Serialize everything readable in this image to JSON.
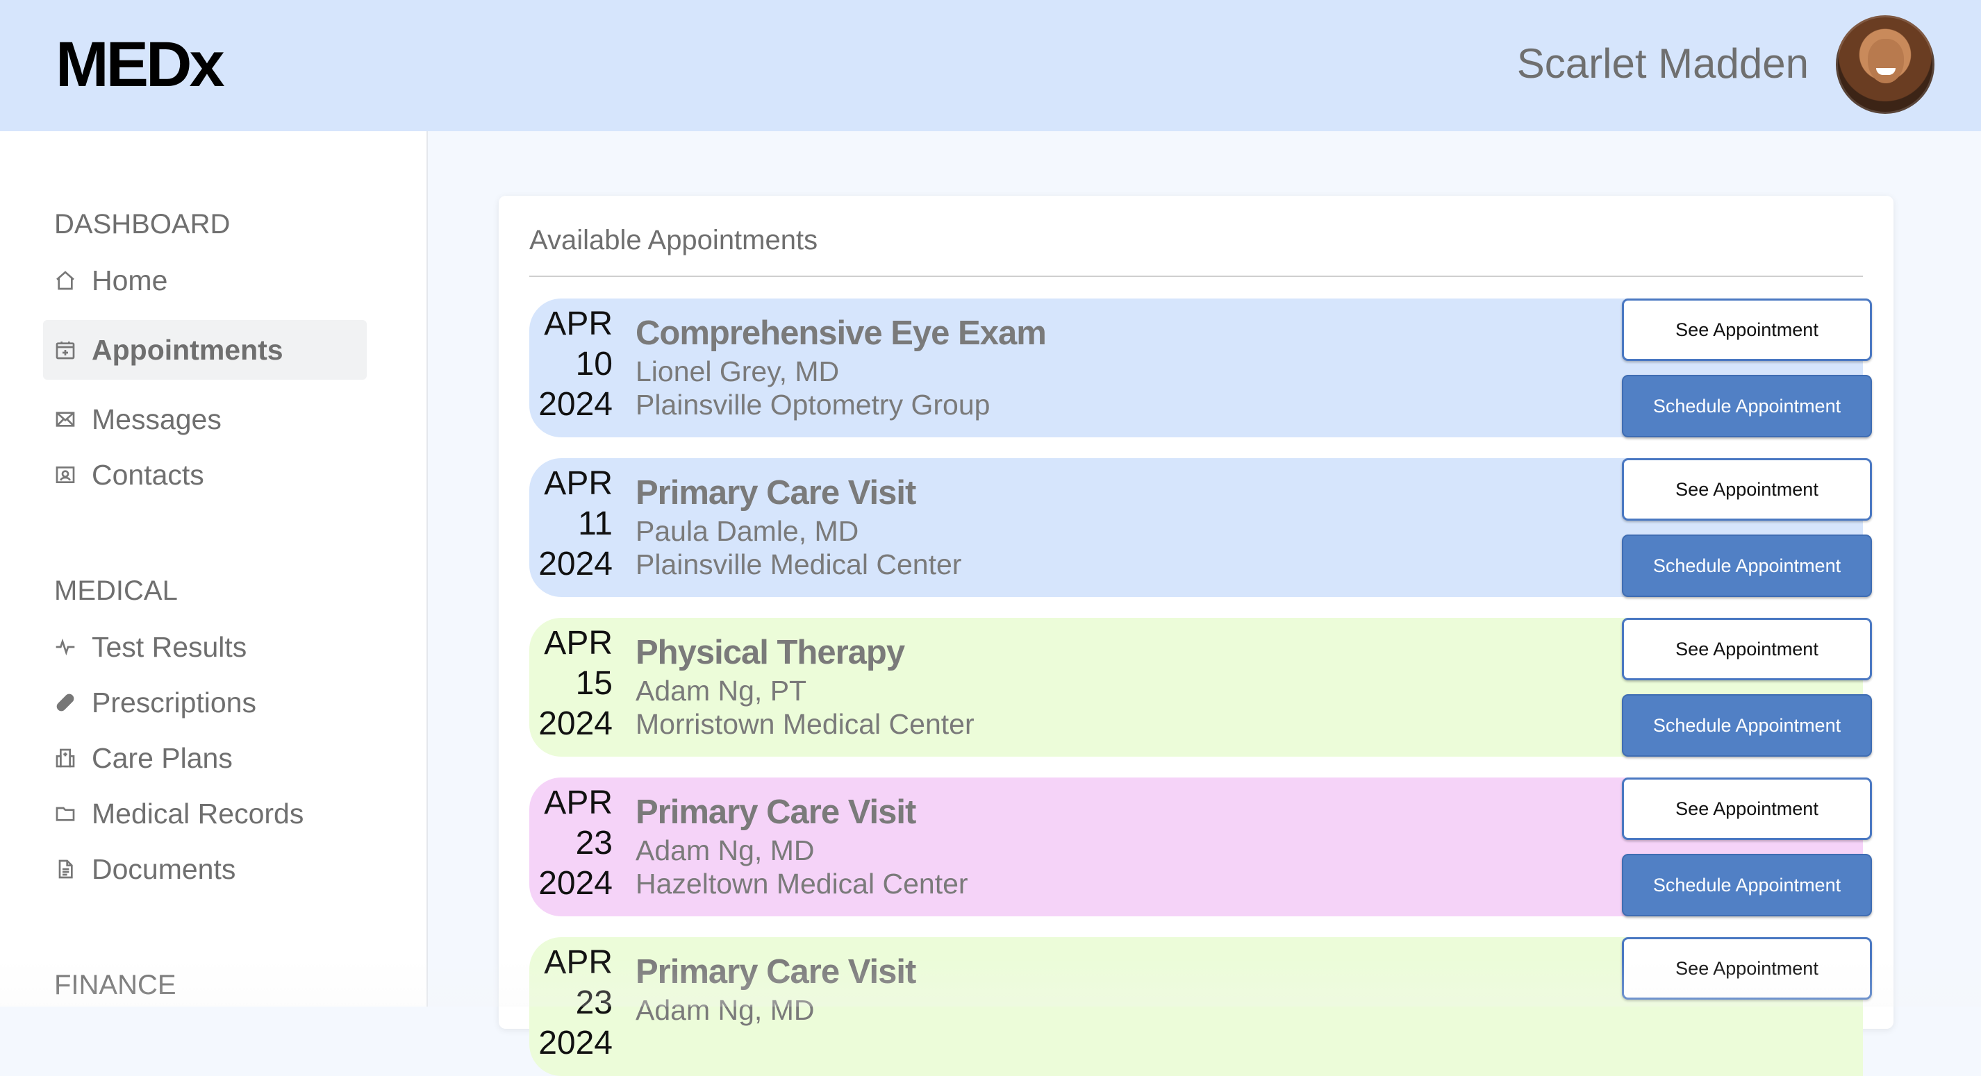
{
  "header": {
    "logo": "MEDx",
    "user_name": "Scarlet Madden",
    "avatar": "user-avatar-photo"
  },
  "sidebar": {
    "sections": [
      {
        "title": "DASHBOARD",
        "items": [
          {
            "label": "Home",
            "icon": "home-icon"
          },
          {
            "label": "Appointments",
            "icon": "calendar-plus-icon",
            "active": true
          },
          {
            "label": "Messages",
            "icon": "envelope-icon"
          },
          {
            "label": "Contacts",
            "icon": "contact-card-icon"
          }
        ]
      },
      {
        "title": "MEDICAL",
        "items": [
          {
            "label": "Test Results",
            "icon": "pulse-icon"
          },
          {
            "label": "Prescriptions",
            "icon": "pill-icon"
          },
          {
            "label": "Care Plans",
            "icon": "hospital-icon"
          },
          {
            "label": "Medical Records",
            "icon": "folder-icon"
          },
          {
            "label": "Documents",
            "icon": "document-icon"
          }
        ]
      },
      {
        "title": "FINANCE",
        "items": []
      }
    ]
  },
  "main": {
    "card_title": "Available Appointments",
    "see_label": "See Appointment",
    "schedule_label": "Schedule Appointment",
    "appointments": [
      {
        "month": "APR",
        "day": "10",
        "year": "2024",
        "title": "Comprehensive Eye Exam",
        "doctor": "Lionel Grey, MD",
        "location": "Plainsville Optometry Group",
        "color": "#d6e5fc"
      },
      {
        "month": "APR",
        "day": "11",
        "year": "2024",
        "title": "Primary Care Visit",
        "doctor": "Paula Damle, MD",
        "location": "Plainsville Medical Center",
        "color": "#d6e5fc"
      },
      {
        "month": "APR",
        "day": "15",
        "year": "2024",
        "title": "Physical Therapy",
        "doctor": "Adam Ng, PT",
        "location": "Morristown Medical Center",
        "color": "#ecfcd9"
      },
      {
        "month": "APR",
        "day": "23",
        "year": "2024",
        "title": "Primary Care Visit",
        "doctor": "Adam Ng, MD",
        "location": "Hazeltown Medical Center",
        "color": "#f5d3f8"
      },
      {
        "month": "APR",
        "day": "23",
        "year": "2024",
        "title": "Primary Care Visit",
        "doctor": "Adam Ng, MD",
        "location": "",
        "color": "#ecfcd9"
      }
    ]
  }
}
